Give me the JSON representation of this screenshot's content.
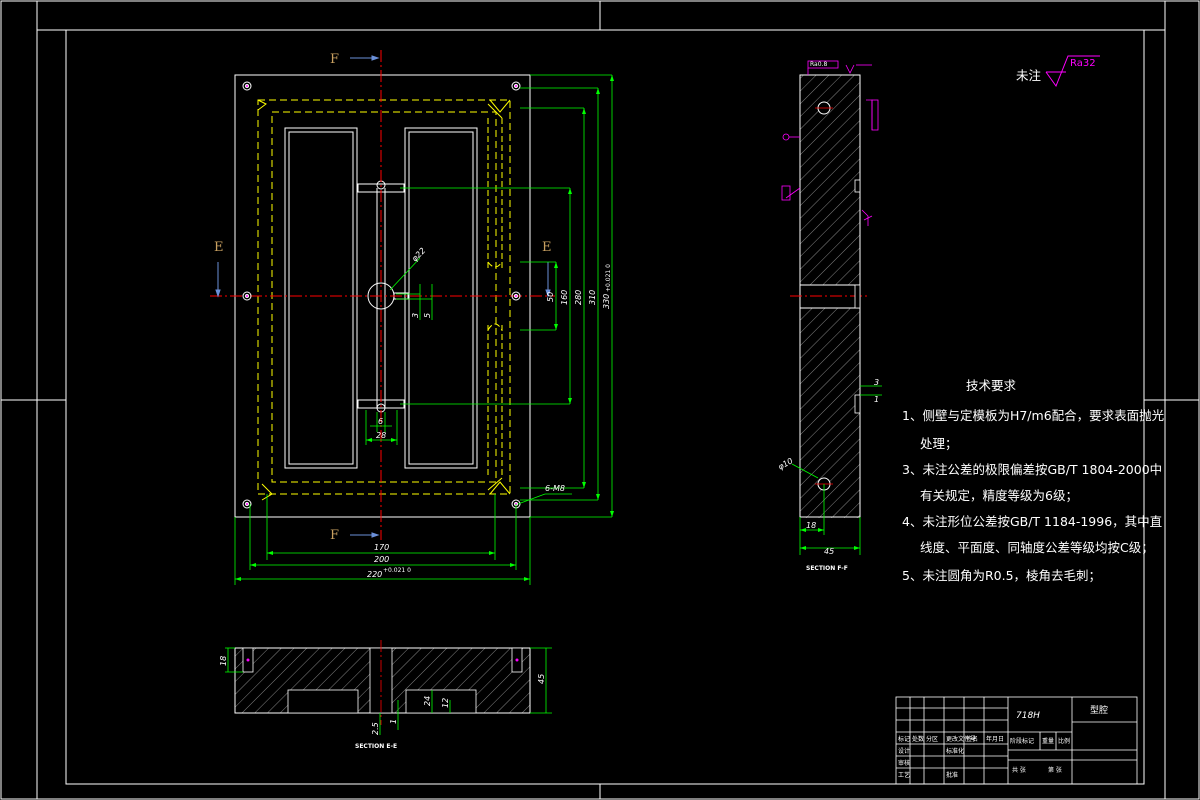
{
  "colors": {
    "background": "#000000",
    "outline": "#ffffff",
    "hidden": "#ffff00",
    "dimension": "#00ff00",
    "center": "#ff0000",
    "section_arrow": "#6a8fd8",
    "label": "#c8a060",
    "hole": "#ff00ff"
  },
  "sections": {
    "f_top": "F",
    "f_bottom": "F",
    "e_left": "E",
    "e_right": "E",
    "side_caption": "SECTION F-F",
    "bottom_caption": "SECTION E-E"
  },
  "dimensions": {
    "front": {
      "d_small": "3",
      "d_5": "5",
      "d_28": "28",
      "d_6": "6",
      "d_50": "50",
      "d_160": "160",
      "d_280": "280",
      "d_310": "310",
      "d_330": "330",
      "d_330_tol": "+0.021 0",
      "d_phi22": "φ22",
      "d_170": "170",
      "d_200": "200",
      "d_220": "220",
      "d_220_tol": "+0.021 0",
      "d_6m8": "6-M8"
    },
    "side": {
      "d_45": "45",
      "d_18": "18",
      "d_3": "3",
      "d_1": "1",
      "d_phi10": "φ10",
      "ra_small": "Ra0.8"
    },
    "bottom": {
      "d_18": "18",
      "d_45": "45",
      "d_25": "2.5",
      "d_1": "1",
      "d_24": "24",
      "d_12": "12"
    }
  },
  "roughness": {
    "label": "未注",
    "value": "Ra32"
  },
  "notes": {
    "title": "技术要求",
    "lines": [
      "1、侧壁与定模板为H7/m6配合，要求表面抛光",
      "处理；",
      "3、未注公差的极限偏差按GB/T 1804-2000中",
      "有关规定，精度等级为6级；",
      "4、未注形位公差按GB/T 1184-1996，其中直",
      "线度、平面度、同轴度公差等级均按C级；",
      "5、未注圆角为R0.5，棱角去毛刺；"
    ]
  },
  "title_block": {
    "material": "718H",
    "name": "型腔",
    "row_labels": [
      "标记",
      "处数",
      "分区",
      "更改文件号",
      "签名",
      "年月日"
    ],
    "row2_labels": [
      "设计",
      "标准化",
      "阶段标记",
      "重量",
      "比例"
    ],
    "row3_labels": [
      "审核"
    ],
    "row4_labels": [
      "工艺",
      "批准",
      "共 张",
      "第 张"
    ]
  }
}
